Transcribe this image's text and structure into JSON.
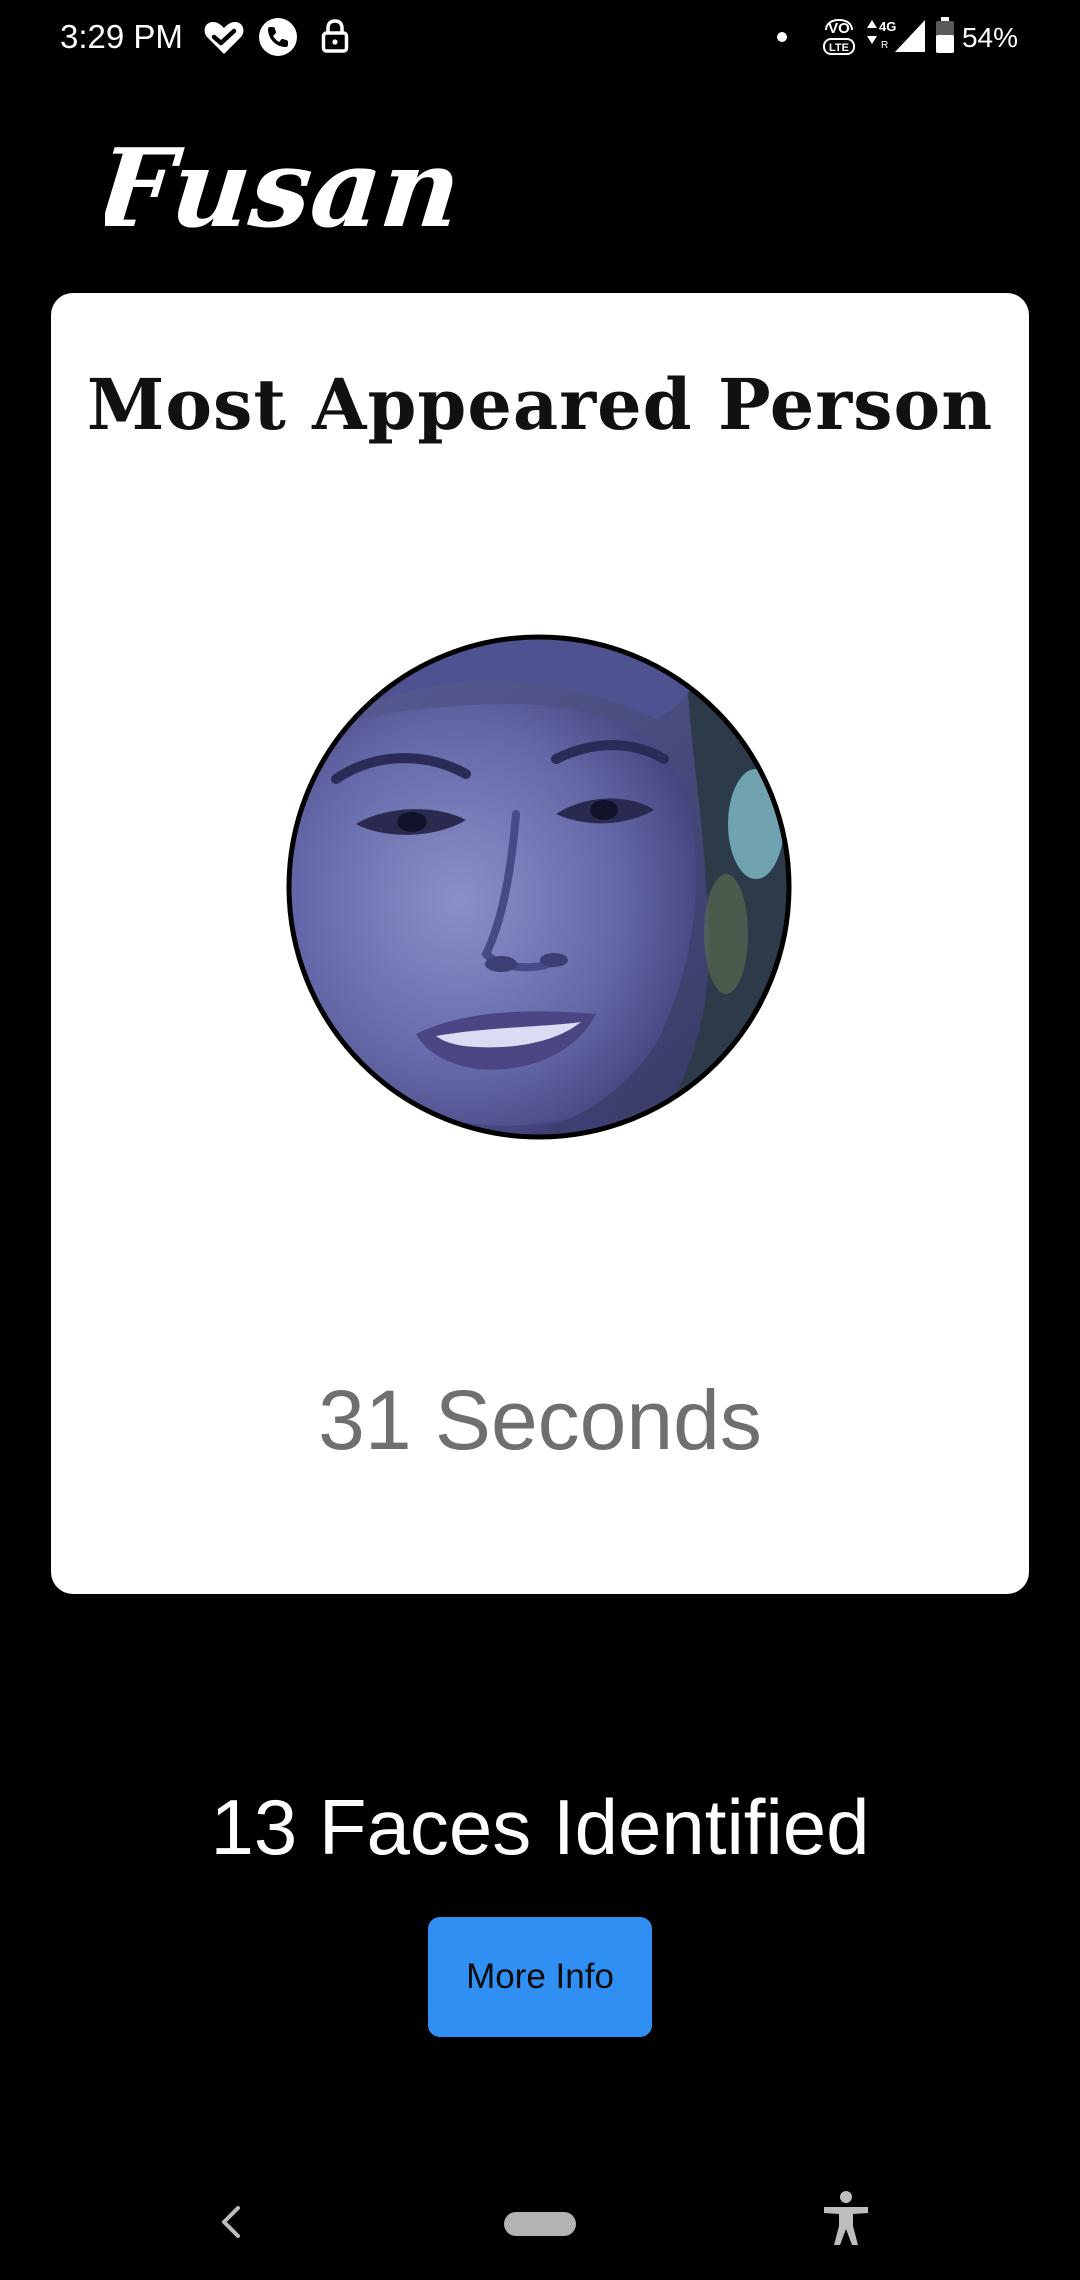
{
  "status_bar": {
    "time": "3:29 PM",
    "battery_percent": "54%",
    "icons": [
      "heart-check-icon",
      "phone-call-icon",
      "lock-icon",
      "notification-dot-icon",
      "volte-icon",
      "data-arrows-icon",
      "signal-icon",
      "battery-icon"
    ]
  },
  "app": {
    "brand": "Fusan"
  },
  "card": {
    "title": "Most Appeared Person",
    "duration": "31 Seconds",
    "avatar_icon": "face-avatar"
  },
  "summary": {
    "faces_identified": "13 Faces Identified",
    "more_info_label": "More Info",
    "button_color": "#2f8ff3"
  },
  "nav_bar": {
    "icons": [
      "back-icon",
      "home-pill",
      "accessibility-icon"
    ]
  }
}
